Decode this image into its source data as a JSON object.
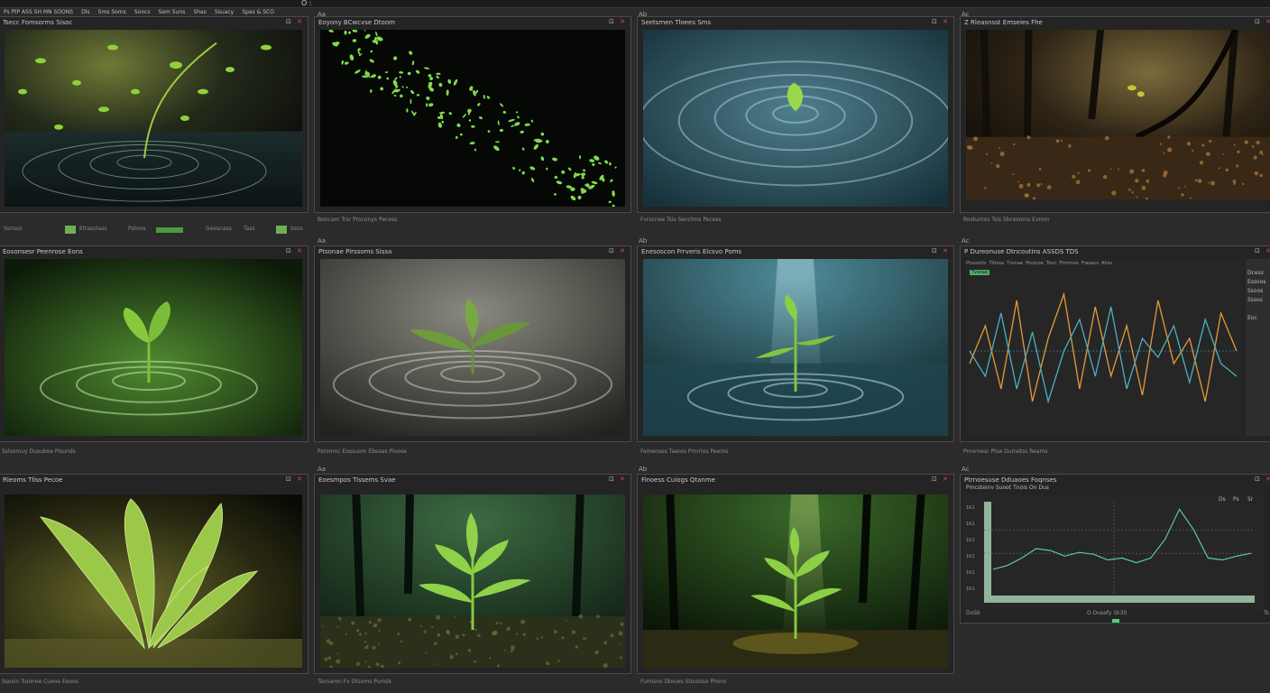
{
  "app": {
    "title": "Ps PtP ASS SH MN SOONS",
    "menu": [
      "Dls",
      "Sms Soms",
      "Soocs",
      "Sem Suns",
      "Shas",
      "Ssuacy",
      "Spas & SCO"
    ],
    "indicator": "O :"
  },
  "columns": [
    "Aa",
    "Ab",
    "Ac",
    "Ad"
  ],
  "panels": [
    {
      "title": "Tsecc Fomsorms Sisoc",
      "caption": "",
      "image": "sprout-ripple-green"
    },
    {
      "title": "Eoyony BCwcvse Dtoom",
      "caption": "Boncam Trsr Proconys Pecess",
      "image": "flying-leaves"
    },
    {
      "title": "Seetsmen Tloees Sms",
      "caption": "Fvrscnee Tsis Senctms Pecess",
      "image": "water-leaf"
    },
    {
      "title": "Z Rleasnsst Emseies Fhe",
      "caption": "Rostumos Tsis Sbcesoms Evrom",
      "image": "forest-root"
    },
    {
      "title": "Eosonsesr Peenrose Eons",
      "caption": "Sslsomuy Dusuboe Pisunds",
      "image": "sprout-green-pond"
    },
    {
      "title": "Ptsonae Pirssoms Sissa",
      "caption": "Psromnc Eossuom Ebeses Pivose",
      "image": "sprout-gray-ripple"
    },
    {
      "title": "Enesoscon Frrveris Eicsvo Poms",
      "caption": "Famenses Taeres Pmrrios Peems",
      "image": "sprout-blue-pond"
    },
    {
      "title": "P Dureonuse Dtncoutins ASSDS TDS",
      "caption": "Pmornesr Ptse Duinetss Reams",
      "image": "waveform"
    },
    {
      "title": "Rleoms Tliss Pecoe",
      "caption": "Ssosin Tuoinoe Cueoe Eeoos",
      "image": "sprout-closeup"
    },
    {
      "title": "Eoesmpos Tissems Svae",
      "caption": "Tsonaron Fv Dtsoms Pumsk",
      "image": "sprout-forest-floor"
    },
    {
      "title": "Finoess Cuiogs Qtanme",
      "caption": "Fumisns Dtoues Stoutsso Phons",
      "image": "sprout-light-rays"
    },
    {
      "title": "Ptrnoesuse Dduaoes Foqnses",
      "caption": "",
      "image": "linegraph"
    }
  ],
  "toolbar_row": {
    "items": [
      "Ssnsos",
      "Ettasolass",
      "Pstoos",
      "Geesnass",
      "Tass",
      "Ssos"
    ]
  },
  "chart_panel_8": {
    "toolbar": [
      "Ptsocetis",
      "Titiosa",
      "Tvsnae",
      "Ptsocoe",
      "Tosn",
      "Fhmmse",
      "Fraoacs",
      "Ahss",
      "Fusoms"
    ],
    "tag": "Tvsnae",
    "sidebar": [
      "Dcess",
      "Essoos",
      "Ssoos",
      "Sssos",
      "Eoc"
    ]
  },
  "chart_panel_12": {
    "subtitle": "Pmcsteinv Suoot Tnois On Dus",
    "y_ticks": [
      "1K1",
      "1K1",
      "1K1",
      "1K1",
      "1K1",
      "1K1"
    ],
    "x_label": "O  Dusefy Sk30",
    "left_label": "DxSb",
    "right_label": "Ts",
    "side": [
      "Ds",
      "Ps",
      "Sr"
    ]
  },
  "chart_data": [
    {
      "type": "line",
      "series": [
        {
          "values": [
            0.4,
            0.7,
            0.2,
            0.9,
            0.1,
            0.6,
            0.95,
            0.2,
            0.85,
            0.3,
            0.7,
            0.15,
            0.9,
            0.4,
            0.6,
            0.1,
            0.8,
            0.5
          ]
        },
        {
          "values": [
            0.5,
            0.3,
            0.8,
            0.2,
            0.65,
            0.1,
            0.5,
            0.75,
            0.3,
            0.85,
            0.2,
            0.6,
            0.45,
            0.7,
            0.25,
            0.75,
            0.4,
            0.3
          ]
        }
      ],
      "colors": [
        "#e49a3b",
        "#4bb1bf"
      ],
      "grid": false
    },
    {
      "type": "line",
      "series": [
        {
          "values": [
            0.28,
            0.32,
            0.4,
            0.5,
            0.48,
            0.42,
            0.46,
            0.44,
            0.38,
            0.4,
            0.35,
            0.4,
            0.6,
            0.92,
            0.7,
            0.4,
            0.38,
            0.42,
            0.45
          ]
        }
      ],
      "colors": [
        "#5cc8a4"
      ],
      "grid": true
    }
  ],
  "colors": {
    "accent": "#6fae55",
    "panel_border": "#4a4a4a",
    "bg": "#2b2b2b"
  }
}
